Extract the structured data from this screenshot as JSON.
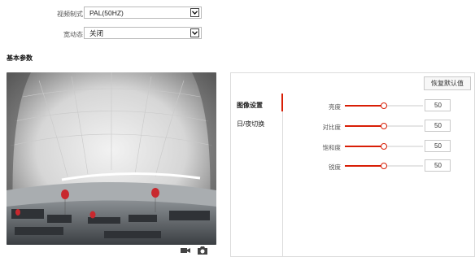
{
  "settings": {
    "video_standard": {
      "label": "视频制式",
      "value": "PAL(50HZ)"
    },
    "wdr": {
      "label": "宽动态",
      "value": "关闭"
    }
  },
  "section_title": "基本参数",
  "right_panel": {
    "reset_label": "恢复默认值",
    "tabs": [
      {
        "label": "图像设置",
        "active": true
      },
      {
        "label": "日/夜切换",
        "active": false
      }
    ],
    "sliders": [
      {
        "label": "亮度",
        "value": "50",
        "fraction": 0.5
      },
      {
        "label": "对比度",
        "value": "50",
        "fraction": 0.5
      },
      {
        "label": "饱和度",
        "value": "50",
        "fraction": 0.5
      },
      {
        "label": "锐度",
        "value": "50",
        "fraction": 0.5
      }
    ]
  },
  "video_tools": {
    "record_icon": "video-camera-icon",
    "snapshot_icon": "camera-icon"
  },
  "colors": {
    "accent": "#d81e06"
  }
}
